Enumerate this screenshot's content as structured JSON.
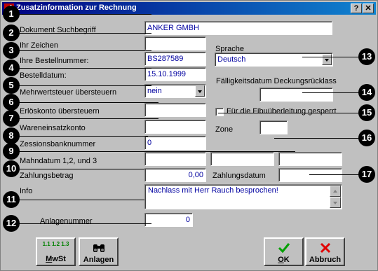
{
  "window": {
    "title": "Zusatzinformation zur Rechnung",
    "help_label": "?",
    "close_label": "✕"
  },
  "fields": {
    "dokument_suchbegriff": {
      "label": "Dokument Suchbegriff",
      "value": "ANKER GMBH"
    },
    "ihr_zeichen": {
      "label": "Ihr Zeichen",
      "value": ""
    },
    "ihre_bestellnummer": {
      "label": "Ihre Bestellnummer:",
      "value": "BS287589"
    },
    "bestelldatum": {
      "label": "Bestelldatum:",
      "value": "15.10.1999"
    },
    "mwst_uebersteuern": {
      "label": "Mehrwertsteuer übersteuern",
      "value": "nein"
    },
    "erloeskonto": {
      "label": "Erlöskonto übersteuern",
      "value": ""
    },
    "wareneinsatzkonto": {
      "label": "Wareneinsatzkonto",
      "value": ""
    },
    "zessionsbanknummer": {
      "label": "Zessionsbanknummer",
      "value": "0"
    },
    "mahndatum": {
      "label": "Mahndatum 1,2, und 3",
      "values": [
        "",
        "",
        ""
      ]
    },
    "zahlungsbetrag": {
      "label": "Zahlungsbetrag",
      "value": "0,00"
    },
    "info": {
      "label": "Info",
      "value": "Nachlass mit Herr Rauch besprochen!"
    },
    "anlagennummer": {
      "label": "Anlagenummer",
      "value": "0"
    },
    "sprache": {
      "label": "Sprache",
      "value": "Deutsch"
    },
    "faelligkeitsdatum": {
      "label": "Fälligkeitsdatum Deckungsrücklass",
      "value": ""
    },
    "fibu_gesperrt": {
      "label": "Für die Fibuüberleitung gesperrt",
      "checked": false
    },
    "zone": {
      "label": "Zone",
      "value": ""
    },
    "zahlungsdatum": {
      "label": "Zahlungsdatum",
      "value": ""
    }
  },
  "callouts": [
    "1",
    "2",
    "3",
    "4",
    "5",
    "6",
    "7",
    "8",
    "9",
    "10",
    "11",
    "12",
    "13",
    "14",
    "15",
    "16",
    "17"
  ],
  "buttons": {
    "mwst": {
      "label_u": "M",
      "label_rest": "wSt",
      "icon_text": "1.1 1.2 1.3"
    },
    "anlagen": {
      "label": "Anlagen"
    },
    "ok": {
      "label_u": "O",
      "label_rest": "K"
    },
    "abbruch": {
      "label": "Abbruch"
    }
  },
  "colors": {
    "title_start": "#000080",
    "title_end": "#1084d0",
    "field_text": "#0000a0",
    "ok_green": "#00a000",
    "cancel_red": "#e00000"
  }
}
